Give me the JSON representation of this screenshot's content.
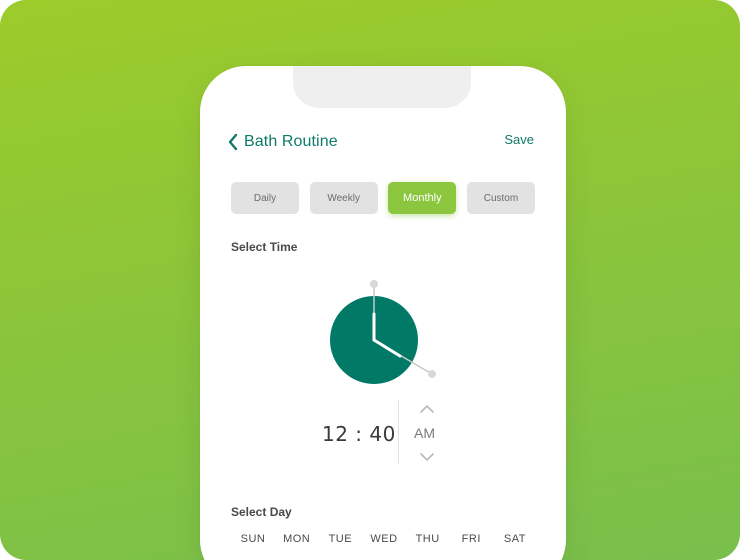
{
  "header": {
    "title": "Bath Routine",
    "save_label": "Save",
    "back_icon": "chevron-left-icon"
  },
  "frequency": {
    "options": [
      "Daily",
      "Weekly",
      "Monthly",
      "Custom"
    ],
    "selected": "Monthly"
  },
  "time_section": {
    "label": "Select Time",
    "time": "12 : 40",
    "period": "AM",
    "hour": 12,
    "minute": 40
  },
  "day_section": {
    "label": "Select Day",
    "days": [
      "SUN",
      "MON",
      "TUE",
      "WED",
      "THU",
      "FRI",
      "SAT"
    ]
  },
  "colors": {
    "accent_teal": "#0e7a6a",
    "accent_green": "#8cc63f",
    "clock_face": "#007a66",
    "background_gradient_start": "#9ccc2a",
    "background_gradient_end": "#79bf4c"
  }
}
